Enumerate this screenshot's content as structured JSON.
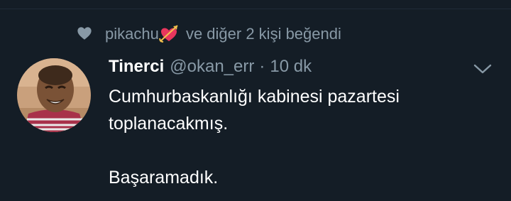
{
  "social_context": {
    "user": "pikachu",
    "emoji": "heart-with-arrow",
    "rest": " ve diğer 2 kişi beğendi"
  },
  "tweet": {
    "author_name": "Tinerci",
    "handle": "@okan_err",
    "separator": "·",
    "time": "10 dk",
    "lines": [
      "Cumhurbaskanlığı kabinesi pazartesi",
      "toplanacakmış."
    ],
    "last_line": "Başaramadık."
  },
  "colors": {
    "background": "#141d26",
    "secondary_text": "#8899a6",
    "primary_text": "#ffffff"
  }
}
